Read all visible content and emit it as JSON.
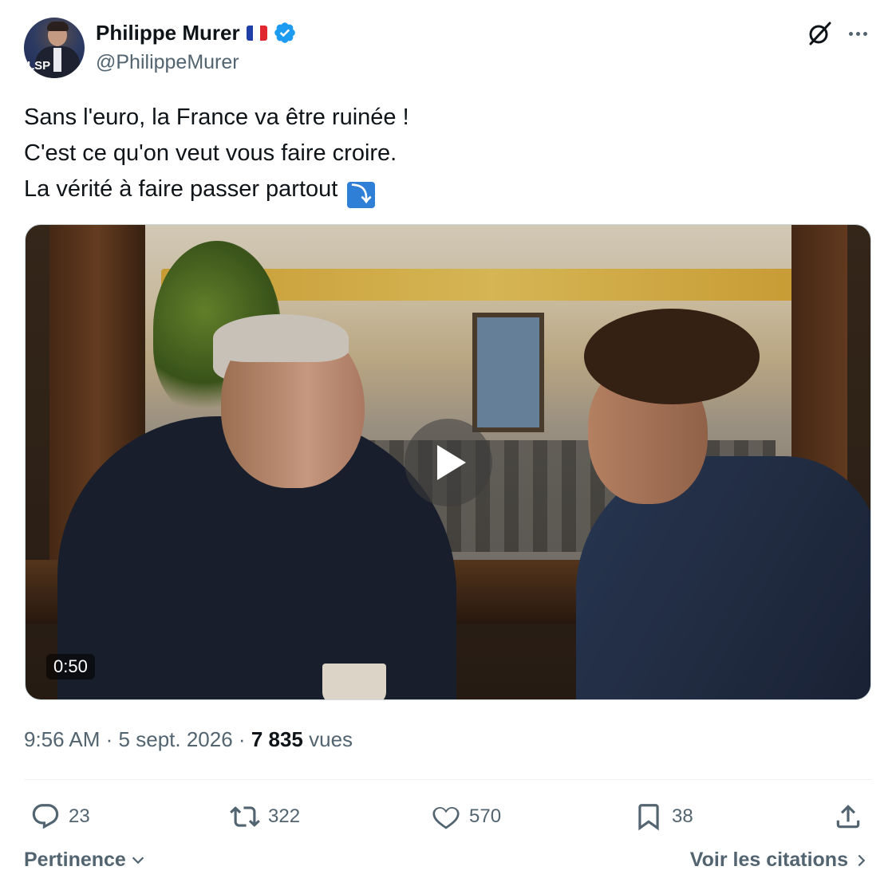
{
  "tweet": {
    "author": {
      "name": "Philippe Murer",
      "handle": "@PhilippeMurer",
      "avatar_logo": "LSP",
      "flag": "french-flag",
      "verified": true,
      "verified_color": "#1d9bf0"
    },
    "text_lines": [
      "Sans l'euro, la France va être ruinée !",
      "C'est ce qu'on veut vous faire croire.",
      "La vérité à faire passer partout"
    ],
    "text_emoji": "⤵",
    "media": {
      "type": "video",
      "duration": "0:50"
    },
    "time": "9:56 AM",
    "separator": "·",
    "date": "5 sept. 2026",
    "views_count": "7 835",
    "views_label": "vues"
  },
  "actions": {
    "replies": "23",
    "reposts": "322",
    "likes": "570",
    "bookmarks": "38"
  },
  "footer": {
    "sort_label": "Pertinence",
    "quotes_label": "Voir les citations"
  },
  "colors": {
    "text": "#0f1419",
    "secondary": "#536471",
    "brand_blue": "#1d9bf0"
  }
}
